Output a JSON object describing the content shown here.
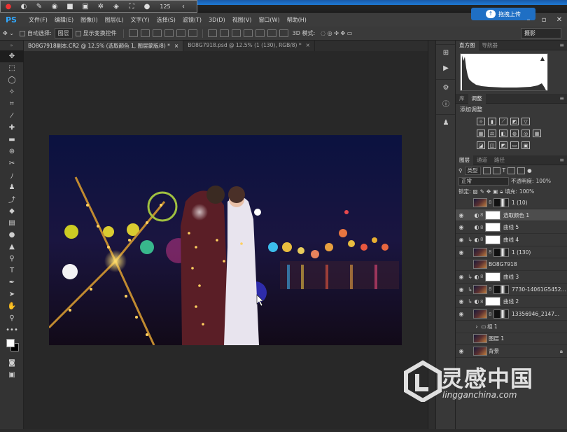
{
  "recorder": {
    "counter": "125"
  },
  "menubar": {
    "logo": "PS",
    "items": [
      "文件(F)",
      "编辑(E)",
      "图像(I)",
      "图层(L)",
      "文字(Y)",
      "选择(S)",
      "滤镜(T)",
      "3D(D)",
      "视图(V)",
      "窗口(W)",
      "帮助(H)"
    ]
  },
  "upload_button": {
    "label": "拖拽上传"
  },
  "options": {
    "auto_select_label": "自动选择:",
    "auto_select_value": "图层",
    "transform_label": "显示变换控件",
    "mode_3d_label": "3D 模式:",
    "workspace": "摄影"
  },
  "tabs": [
    {
      "label": "BO8G7918副本.CR2 @ 12.5% (选取颜色 1, 图层蒙版/8) *"
    },
    {
      "label": "BO8G7918.psd @ 12.5% (1 (130), RGB/8) *"
    }
  ],
  "panels": {
    "top_tabs": [
      "直方图",
      "导航器"
    ],
    "adj_tabs": [
      "库",
      "调整"
    ],
    "adj_title": "添加调整",
    "layers_tabs": [
      "图层",
      "通道",
      "路径"
    ],
    "kind_filter": "类型",
    "blend_mode": "正常",
    "opacity_label": "不透明度:",
    "opacity_value": "100%",
    "lock_label": "锁定:",
    "fill_label": "填充:",
    "fill_value": "100%"
  },
  "layers": [
    {
      "name": "1 (10)",
      "visible": false,
      "kind": "image"
    },
    {
      "name": "选取颜色 1",
      "visible": true,
      "kind": "adjust",
      "selected": true
    },
    {
      "name": "曲线 5",
      "visible": true,
      "kind": "adjust"
    },
    {
      "name": "曲线 4",
      "visible": true,
      "kind": "adjust",
      "clip": true
    },
    {
      "name": "1 (130)",
      "visible": true,
      "kind": "image"
    },
    {
      "name": "BO8G7918",
      "visible": false,
      "kind": "image"
    },
    {
      "name": "曲线 3",
      "visible": true,
      "kind": "adjust",
      "clip": true
    },
    {
      "name": "7730-14061G5452...",
      "visible": true,
      "kind": "image",
      "clip": true
    },
    {
      "name": "曲线 2",
      "visible": true,
      "kind": "adjust",
      "clip": true
    },
    {
      "name": "13356946_2147...",
      "visible": true,
      "kind": "image"
    },
    {
      "name": "组 1",
      "visible": false,
      "kind": "group"
    },
    {
      "name": "图层 1",
      "visible": false,
      "kind": "image"
    },
    {
      "name": "背景",
      "visible": true,
      "kind": "image",
      "locked": true
    }
  ],
  "watermark": {
    "brand": "灵感中国",
    "url": "lingganchina.com"
  }
}
